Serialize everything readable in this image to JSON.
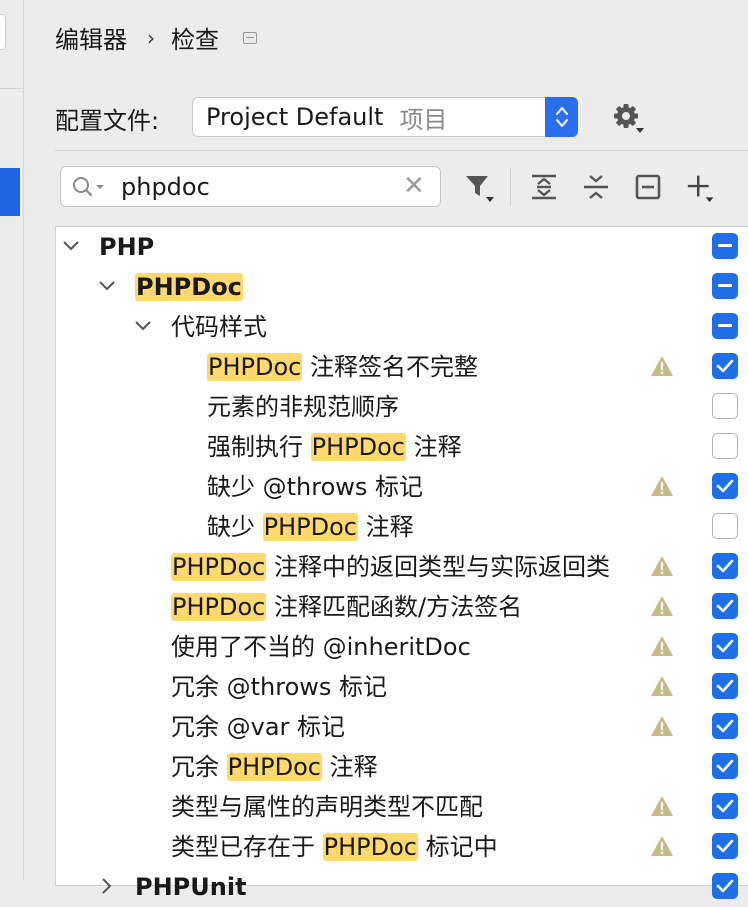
{
  "breadcrumb": {
    "parent": "编辑器",
    "separator": "›",
    "current": "检查"
  },
  "profile": {
    "label": "配置文件:",
    "name": "Project Default",
    "scope": "项目"
  },
  "search": {
    "value": "phpdoc"
  },
  "icons": {
    "search": "search-icon",
    "filter": "filter-icon",
    "expand": "expand-all-icon",
    "collapse": "collapse-all-icon",
    "reset": "reset-icon",
    "add": "add-icon",
    "gear": "gear-icon",
    "warning": "warning-icon"
  },
  "colors": {
    "accent": "#1f6fe8",
    "highlight": "#fed870",
    "warning": "#c9b88a"
  },
  "tree": [
    {
      "level": 0,
      "expanded": true,
      "parts": [
        {
          "t": "PHP",
          "hl": false
        }
      ],
      "bold": true,
      "warn": false,
      "check": "mixed"
    },
    {
      "level": 1,
      "expanded": true,
      "parts": [
        {
          "t": "PHPDoc",
          "hl": true
        }
      ],
      "bold": true,
      "warn": false,
      "check": "mixed"
    },
    {
      "level": 2,
      "expanded": true,
      "parts": [
        {
          "t": "代码样式",
          "hl": false
        }
      ],
      "bold": false,
      "warn": false,
      "check": "mixed"
    },
    {
      "level": 3,
      "parts": [
        {
          "t": "PHPDoc",
          "hl": true
        },
        {
          "t": " 注释签名不完整",
          "hl": false
        }
      ],
      "bold": false,
      "warn": true,
      "check": "on"
    },
    {
      "level": 3,
      "parts": [
        {
          "t": "元素的非规范顺序",
          "hl": false
        }
      ],
      "bold": false,
      "warn": false,
      "check": "off"
    },
    {
      "level": 3,
      "parts": [
        {
          "t": "强制执行 ",
          "hl": false
        },
        {
          "t": "PHPDoc",
          "hl": true
        },
        {
          "t": " 注释",
          "hl": false
        }
      ],
      "bold": false,
      "warn": false,
      "check": "off"
    },
    {
      "level": 3,
      "parts": [
        {
          "t": "缺少 @throws 标记",
          "hl": false
        }
      ],
      "bold": false,
      "warn": true,
      "check": "on"
    },
    {
      "level": 3,
      "parts": [
        {
          "t": "缺少 ",
          "hl": false
        },
        {
          "t": "PHPDoc",
          "hl": true
        },
        {
          "t": " 注释",
          "hl": false
        }
      ],
      "bold": false,
      "warn": false,
      "check": "off"
    },
    {
      "level": 2,
      "parts": [
        {
          "t": "PHPDoc",
          "hl": true
        },
        {
          "t": " 注释中的返回类型与实际返回类",
          "hl": false
        }
      ],
      "bold": false,
      "warn": true,
      "check": "on"
    },
    {
      "level": 2,
      "parts": [
        {
          "t": "PHPDoc",
          "hl": true
        },
        {
          "t": " 注释匹配函数/方法签名",
          "hl": false
        }
      ],
      "bold": false,
      "warn": true,
      "check": "on"
    },
    {
      "level": 2,
      "parts": [
        {
          "t": "使用了不当的 @inheritDoc",
          "hl": false
        }
      ],
      "bold": false,
      "warn": true,
      "check": "on"
    },
    {
      "level": 2,
      "parts": [
        {
          "t": "冗余 @throws 标记",
          "hl": false
        }
      ],
      "bold": false,
      "warn": true,
      "check": "on"
    },
    {
      "level": 2,
      "parts": [
        {
          "t": "冗余 @var 标记",
          "hl": false
        }
      ],
      "bold": false,
      "warn": true,
      "check": "on"
    },
    {
      "level": 2,
      "parts": [
        {
          "t": "冗余 ",
          "hl": false
        },
        {
          "t": "PHPDoc",
          "hl": true
        },
        {
          "t": " 注释",
          "hl": false
        }
      ],
      "bold": false,
      "warn": false,
      "check": "on"
    },
    {
      "level": 2,
      "parts": [
        {
          "t": "类型与属性的声明类型不匹配",
          "hl": false
        }
      ],
      "bold": false,
      "warn": true,
      "check": "on"
    },
    {
      "level": 2,
      "parts": [
        {
          "t": "类型已存在于 ",
          "hl": false
        },
        {
          "t": "PHPDoc",
          "hl": true
        },
        {
          "t": " 标记中",
          "hl": false
        }
      ],
      "bold": false,
      "warn": true,
      "check": "on"
    },
    {
      "level": 1,
      "expanded": false,
      "parts": [
        {
          "t": "PHPUnit",
          "hl": false
        }
      ],
      "bold": true,
      "warn": false,
      "check": "on"
    }
  ]
}
